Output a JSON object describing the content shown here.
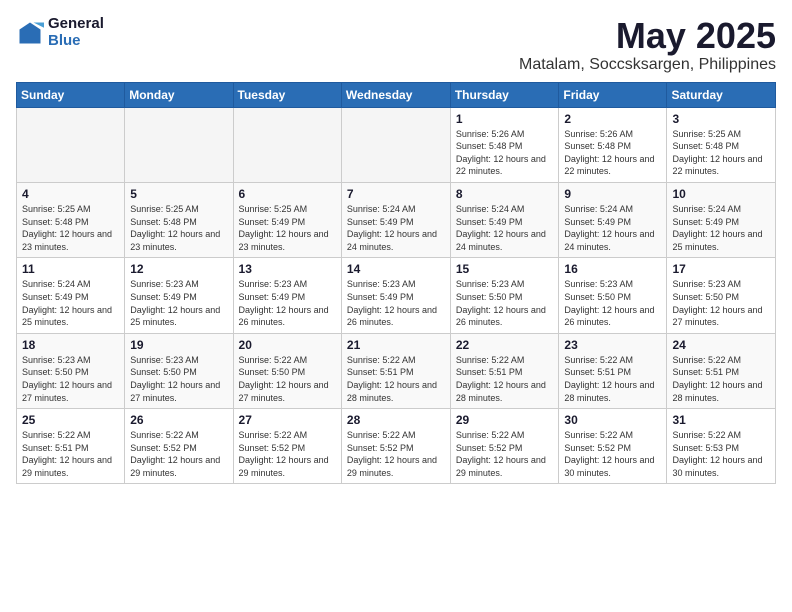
{
  "header": {
    "logo": {
      "general": "General",
      "blue": "Blue"
    },
    "month": "May 2025",
    "location": "Matalam, Soccsksargen, Philippines"
  },
  "days_of_week": [
    "Sunday",
    "Monday",
    "Tuesday",
    "Wednesday",
    "Thursday",
    "Friday",
    "Saturday"
  ],
  "weeks": [
    [
      {
        "day": "",
        "sunrise": "",
        "sunset": "",
        "daylight": ""
      },
      {
        "day": "",
        "sunrise": "",
        "sunset": "",
        "daylight": ""
      },
      {
        "day": "",
        "sunrise": "",
        "sunset": "",
        "daylight": ""
      },
      {
        "day": "",
        "sunrise": "",
        "sunset": "",
        "daylight": ""
      },
      {
        "day": "1",
        "sunrise": "Sunrise: 5:26 AM",
        "sunset": "Sunset: 5:48 PM",
        "daylight": "Daylight: 12 hours and 22 minutes."
      },
      {
        "day": "2",
        "sunrise": "Sunrise: 5:26 AM",
        "sunset": "Sunset: 5:48 PM",
        "daylight": "Daylight: 12 hours and 22 minutes."
      },
      {
        "day": "3",
        "sunrise": "Sunrise: 5:25 AM",
        "sunset": "Sunset: 5:48 PM",
        "daylight": "Daylight: 12 hours and 22 minutes."
      }
    ],
    [
      {
        "day": "4",
        "sunrise": "Sunrise: 5:25 AM",
        "sunset": "Sunset: 5:48 PM",
        "daylight": "Daylight: 12 hours and 23 minutes."
      },
      {
        "day": "5",
        "sunrise": "Sunrise: 5:25 AM",
        "sunset": "Sunset: 5:48 PM",
        "daylight": "Daylight: 12 hours and 23 minutes."
      },
      {
        "day": "6",
        "sunrise": "Sunrise: 5:25 AM",
        "sunset": "Sunset: 5:49 PM",
        "daylight": "Daylight: 12 hours and 23 minutes."
      },
      {
        "day": "7",
        "sunrise": "Sunrise: 5:24 AM",
        "sunset": "Sunset: 5:49 PM",
        "daylight": "Daylight: 12 hours and 24 minutes."
      },
      {
        "day": "8",
        "sunrise": "Sunrise: 5:24 AM",
        "sunset": "Sunset: 5:49 PM",
        "daylight": "Daylight: 12 hours and 24 minutes."
      },
      {
        "day": "9",
        "sunrise": "Sunrise: 5:24 AM",
        "sunset": "Sunset: 5:49 PM",
        "daylight": "Daylight: 12 hours and 24 minutes."
      },
      {
        "day": "10",
        "sunrise": "Sunrise: 5:24 AM",
        "sunset": "Sunset: 5:49 PM",
        "daylight": "Daylight: 12 hours and 25 minutes."
      }
    ],
    [
      {
        "day": "11",
        "sunrise": "Sunrise: 5:24 AM",
        "sunset": "Sunset: 5:49 PM",
        "daylight": "Daylight: 12 hours and 25 minutes."
      },
      {
        "day": "12",
        "sunrise": "Sunrise: 5:23 AM",
        "sunset": "Sunset: 5:49 PM",
        "daylight": "Daylight: 12 hours and 25 minutes."
      },
      {
        "day": "13",
        "sunrise": "Sunrise: 5:23 AM",
        "sunset": "Sunset: 5:49 PM",
        "daylight": "Daylight: 12 hours and 26 minutes."
      },
      {
        "day": "14",
        "sunrise": "Sunrise: 5:23 AM",
        "sunset": "Sunset: 5:49 PM",
        "daylight": "Daylight: 12 hours and 26 minutes."
      },
      {
        "day": "15",
        "sunrise": "Sunrise: 5:23 AM",
        "sunset": "Sunset: 5:50 PM",
        "daylight": "Daylight: 12 hours and 26 minutes."
      },
      {
        "day": "16",
        "sunrise": "Sunrise: 5:23 AM",
        "sunset": "Sunset: 5:50 PM",
        "daylight": "Daylight: 12 hours and 26 minutes."
      },
      {
        "day": "17",
        "sunrise": "Sunrise: 5:23 AM",
        "sunset": "Sunset: 5:50 PM",
        "daylight": "Daylight: 12 hours and 27 minutes."
      }
    ],
    [
      {
        "day": "18",
        "sunrise": "Sunrise: 5:23 AM",
        "sunset": "Sunset: 5:50 PM",
        "daylight": "Daylight: 12 hours and 27 minutes."
      },
      {
        "day": "19",
        "sunrise": "Sunrise: 5:23 AM",
        "sunset": "Sunset: 5:50 PM",
        "daylight": "Daylight: 12 hours and 27 minutes."
      },
      {
        "day": "20",
        "sunrise": "Sunrise: 5:22 AM",
        "sunset": "Sunset: 5:50 PM",
        "daylight": "Daylight: 12 hours and 27 minutes."
      },
      {
        "day": "21",
        "sunrise": "Sunrise: 5:22 AM",
        "sunset": "Sunset: 5:51 PM",
        "daylight": "Daylight: 12 hours and 28 minutes."
      },
      {
        "day": "22",
        "sunrise": "Sunrise: 5:22 AM",
        "sunset": "Sunset: 5:51 PM",
        "daylight": "Daylight: 12 hours and 28 minutes."
      },
      {
        "day": "23",
        "sunrise": "Sunrise: 5:22 AM",
        "sunset": "Sunset: 5:51 PM",
        "daylight": "Daylight: 12 hours and 28 minutes."
      },
      {
        "day": "24",
        "sunrise": "Sunrise: 5:22 AM",
        "sunset": "Sunset: 5:51 PM",
        "daylight": "Daylight: 12 hours and 28 minutes."
      }
    ],
    [
      {
        "day": "25",
        "sunrise": "Sunrise: 5:22 AM",
        "sunset": "Sunset: 5:51 PM",
        "daylight": "Daylight: 12 hours and 29 minutes."
      },
      {
        "day": "26",
        "sunrise": "Sunrise: 5:22 AM",
        "sunset": "Sunset: 5:52 PM",
        "daylight": "Daylight: 12 hours and 29 minutes."
      },
      {
        "day": "27",
        "sunrise": "Sunrise: 5:22 AM",
        "sunset": "Sunset: 5:52 PM",
        "daylight": "Daylight: 12 hours and 29 minutes."
      },
      {
        "day": "28",
        "sunrise": "Sunrise: 5:22 AM",
        "sunset": "Sunset: 5:52 PM",
        "daylight": "Daylight: 12 hours and 29 minutes."
      },
      {
        "day": "29",
        "sunrise": "Sunrise: 5:22 AM",
        "sunset": "Sunset: 5:52 PM",
        "daylight": "Daylight: 12 hours and 29 minutes."
      },
      {
        "day": "30",
        "sunrise": "Sunrise: 5:22 AM",
        "sunset": "Sunset: 5:52 PM",
        "daylight": "Daylight: 12 hours and 30 minutes."
      },
      {
        "day": "31",
        "sunrise": "Sunrise: 5:22 AM",
        "sunset": "Sunset: 5:53 PM",
        "daylight": "Daylight: 12 hours and 30 minutes."
      }
    ]
  ]
}
